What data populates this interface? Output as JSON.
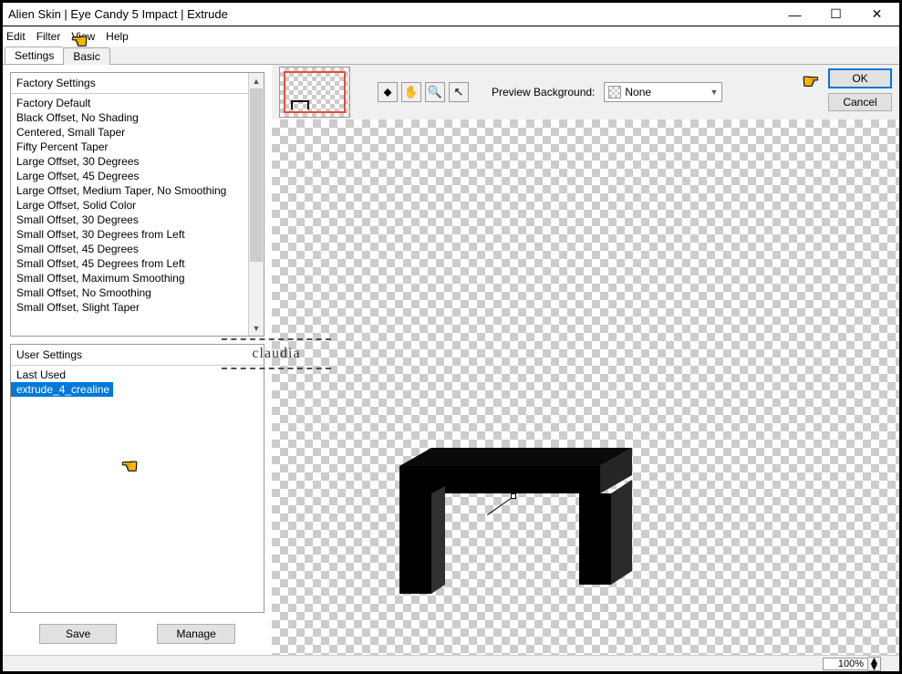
{
  "window": {
    "title": "Alien Skin | Eye Candy 5 Impact | Extrude",
    "minimize": "—",
    "maximize": "☐",
    "close": "✕"
  },
  "menubar": {
    "edit": "Edit",
    "filter": "Filter",
    "view": "View",
    "help": "Help"
  },
  "tabs": {
    "settings": "Settings",
    "basic": "Basic"
  },
  "factory": {
    "header": "Factory Settings",
    "items": [
      "Factory Default",
      "Black Offset, No Shading",
      "Centered, Small Taper",
      "Fifty Percent Taper",
      "Large Offset, 30 Degrees",
      "Large Offset, 45 Degrees",
      "Large Offset, Medium Taper, No Smoothing",
      "Large Offset, Solid Color",
      "Small Offset, 30 Degrees",
      "Small Offset, 30 Degrees from Left",
      "Small Offset, 45 Degrees",
      "Small Offset, 45 Degrees from Left",
      "Small Offset, Maximum Smoothing",
      "Small Offset, No Smoothing",
      "Small Offset, Slight Taper"
    ]
  },
  "user": {
    "header": "User Settings",
    "items": [
      {
        "label": "Last Used",
        "selected": false
      },
      {
        "label": "extrude_4_crealine",
        "selected": true
      }
    ]
  },
  "buttons": {
    "save": "Save",
    "manage": "Manage",
    "ok": "OK",
    "cancel": "Cancel"
  },
  "toolbar": {
    "preview_bg_label": "Preview Background:",
    "preview_bg_value": "None",
    "icons": {
      "warp": "⬥",
      "hand": "✋",
      "zoom": "🔍",
      "pointer": "↖"
    }
  },
  "status": {
    "zoom": "100%"
  },
  "watermark": {
    "text": "claudia"
  }
}
